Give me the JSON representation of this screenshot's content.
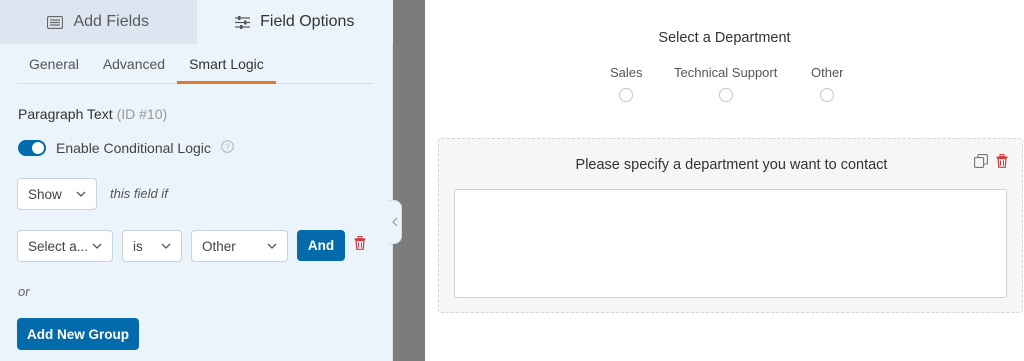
{
  "tabs": {
    "add_fields": "Add Fields",
    "field_options": "Field Options"
  },
  "subtabs": {
    "general": "General",
    "advanced": "Advanced",
    "smart_logic": "Smart Logic"
  },
  "field": {
    "name": "Paragraph Text",
    "id_label": "(ID #10)"
  },
  "conditional": {
    "toggle_label": "Enable Conditional Logic",
    "enabled": true,
    "action_value": "Show",
    "action_suffix": "this field if",
    "rule_field": "Select a...",
    "rule_operator": "is",
    "rule_value": "Other",
    "and_button": "And",
    "or_label": "or",
    "add_group_button": "Add New Group"
  },
  "preview": {
    "radio_label": "Select a Department",
    "radio_options": [
      "Sales",
      "Technical Support",
      "Other"
    ],
    "textarea_label": "Please specify a department you want to contact"
  },
  "colors": {
    "accent": "#036aab",
    "tab_underline": "#e27730",
    "danger": "#d63638",
    "panel_bg": "#ebf3fb",
    "divider": "#7c7c7c"
  }
}
